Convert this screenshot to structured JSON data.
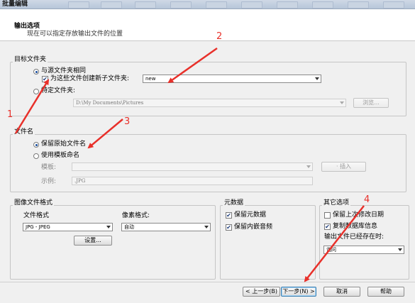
{
  "window": {
    "title": "批量编辑"
  },
  "header": {
    "title": "输出选项",
    "subtitle": "现在可以指定存放输出文件的位置"
  },
  "target_folder": {
    "group_title": "目标文件夹",
    "same_as_source_label": "与源文件夹相同",
    "same_as_source_selected": true,
    "create_subfolder_label": "为这些文件创建新子文件夹:",
    "create_subfolder_checked": true,
    "subfolder_name": "new",
    "specific_folder_label": "特定文件夹:",
    "specific_folder_selected": false,
    "specific_folder_path": "D:\\My Documents\\Pictures",
    "browse_label": "浏览..."
  },
  "file_name": {
    "group_title": "文件名",
    "keep_original_label": "保留原始文件名",
    "keep_original_selected": true,
    "use_template_label": "使用模板命名",
    "use_template_selected": false,
    "template_label": "模板:",
    "template_value": "",
    "insert_label": "插入",
    "example_label": "示例:",
    "example_value": ".JPG"
  },
  "image_format": {
    "group_title": "图像文件格式",
    "file_format_label": "文件格式",
    "file_format_value": "JPG - JPEG",
    "pixel_format_label": "像素格式:",
    "pixel_format_value": "自动",
    "settings_label": "设置..."
  },
  "metadata": {
    "group_title": "元数据",
    "keep_metadata_label": "保留元数据",
    "keep_metadata_checked": true,
    "keep_embedded_audio_label": "保留内嵌音频",
    "keep_embedded_audio_checked": true
  },
  "other_options": {
    "group_title": "其它选项",
    "keep_modified_date_label": "保留上次修改日期",
    "keep_modified_date_checked": false,
    "copy_database_label": "复制数据库信息",
    "copy_database_checked": true,
    "if_exists_label": "输出文件已经存在时:",
    "if_exists_value": "询问"
  },
  "footer": {
    "back_label": "< 上一步(B)",
    "next_label": "下一步(N) >",
    "cancel_label": "取消",
    "help_label": "帮助"
  },
  "annotations": {
    "n1": "1",
    "n2": "2",
    "n3": "3",
    "n4": "4",
    "color": "#e8302a"
  }
}
